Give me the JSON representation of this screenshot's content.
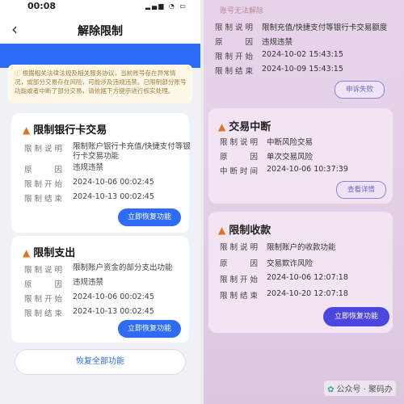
{
  "left": {
    "status_time": "00:08",
    "status_icons": "▂▄▆ ◔ ▭",
    "nav_back": "‹",
    "nav_title": "解除限制",
    "notice_icon": "ⓘ",
    "notice_text": "根据相关法律法规及相关服务协议，当前账号存在异常情况，或部分交易存在风险，可能涉及违规违禁。已限制部分账号功能或者中断了部分交易，请依据下方提示进行核实处理。",
    "cards": [
      {
        "title": "限制银行卡交易",
        "rows": [
          {
            "k": "限制说明",
            "v": "限制账户银行卡充值/快捷支付等银行卡交易功能"
          },
          {
            "k": "原　　因",
            "v": "违规违禁"
          },
          {
            "k": "限制开始",
            "v": "2024-10-06 00:02:45"
          },
          {
            "k": "限制结束",
            "v": "2024-10-13 00:02:45"
          }
        ],
        "button": "立即恢复功能"
      },
      {
        "title": "限制支出",
        "rows": [
          {
            "k": "限制说明",
            "v": "限制账户资金的部分支出功能"
          },
          {
            "k": "原　　因",
            "v": "违规违禁"
          },
          {
            "k": "限制开始",
            "v": "2024-10-06 00:02:45"
          },
          {
            "k": "限制结束",
            "v": "2024-10-13 00:02:45"
          }
        ],
        "button": "立即恢复功能"
      }
    ],
    "restore_all": "恢复全部功能"
  },
  "right": {
    "faint_top": "账号无法解除",
    "top_rows": [
      {
        "k": "限制说明",
        "v": "限制充值/快捷支付等银行卡交易额度"
      },
      {
        "k": "原　　因",
        "v": "违规违禁"
      },
      {
        "k": "限制开始",
        "v": "2024-10-02 15:43:15"
      },
      {
        "k": "限制结束",
        "v": "2024-10-09 15:43:15"
      }
    ],
    "appeal_failed": "申诉失败",
    "card2": {
      "title": "交易中断",
      "rows": [
        {
          "k": "限制说明",
          "v": "中断风险交易"
        },
        {
          "k": "原　　因",
          "v": "单次交易风险"
        },
        {
          "k": "中断时间",
          "v": "2024-10-06 10:37:39"
        }
      ],
      "button": "查看详情"
    },
    "card3": {
      "title": "限制收款",
      "rows": [
        {
          "k": "限制说明",
          "v": "限制账户的收款功能"
        },
        {
          "k": "原　　因",
          "v": "交易欺诈风险"
        },
        {
          "k": "限制开始",
          "v": "2024-10-06 12:07:18"
        },
        {
          "k": "限制结束",
          "v": "2024-10-20 12:07:18"
        }
      ],
      "button": "立即恢复功能"
    },
    "watermark": "公众号 · 聚码办",
    "watermark_icon": "✿"
  }
}
